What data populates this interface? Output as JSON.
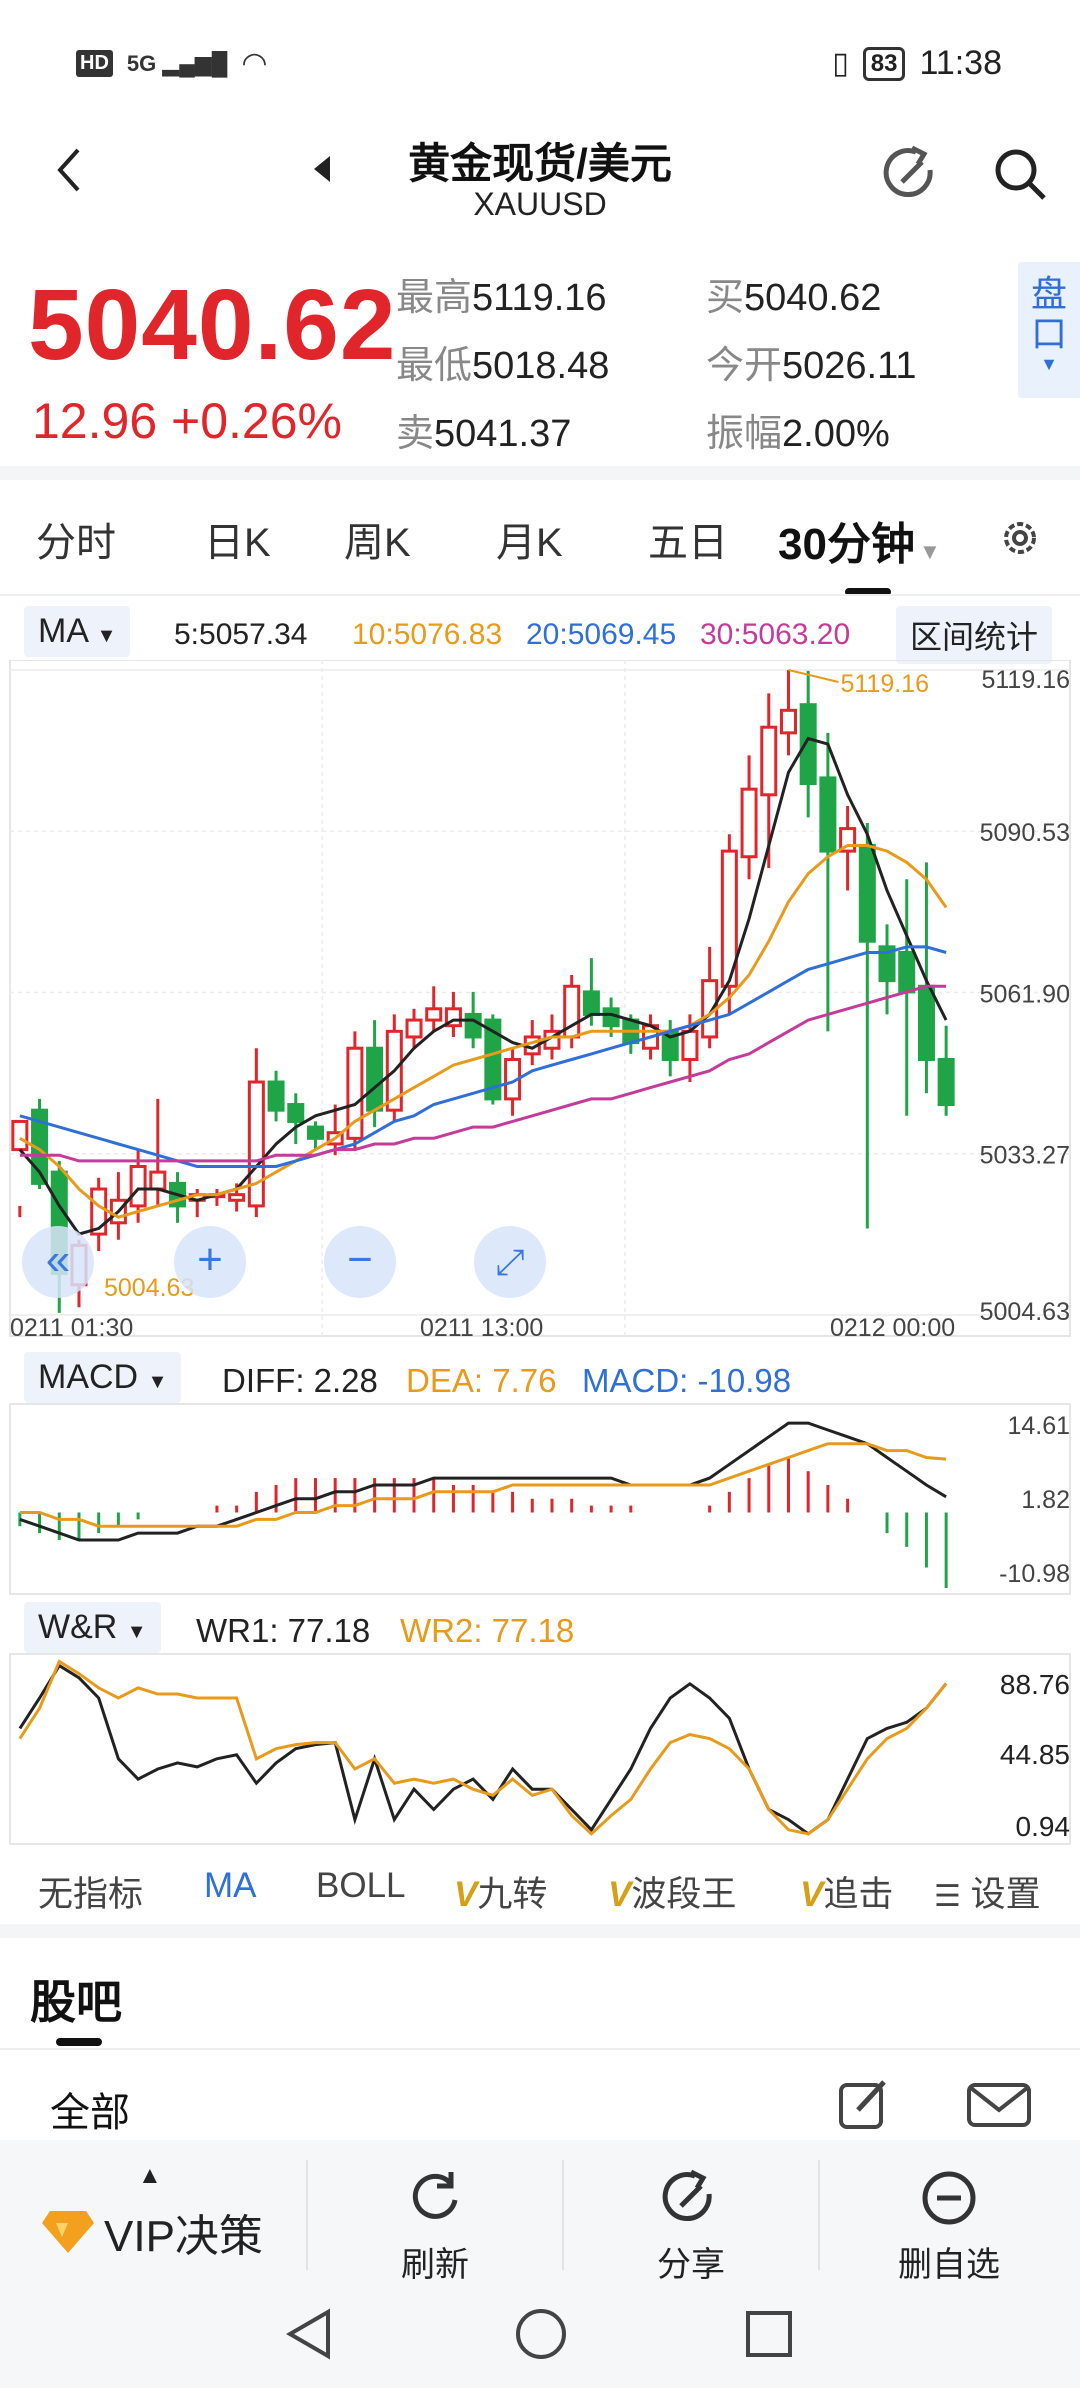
{
  "status": {
    "left_icons": [
      "HD",
      "5G",
      "signal",
      "wifi"
    ],
    "battery": "83",
    "time": "11:38"
  },
  "nav": {
    "title": "黄金现货/美元",
    "subtitle": "XAUUSD"
  },
  "quote": {
    "price": "5040.62",
    "change": "12.96  +0.26%",
    "high_label": "最高",
    "high": "5119.16",
    "low_label": "最低",
    "low": "5018.48",
    "sell_label": "卖",
    "sell": "5041.37",
    "buy_label": "买",
    "buy": "5040.62",
    "open_label": "今开",
    "open": "5026.11",
    "amp_label": "振幅",
    "amp": "2.00%",
    "pan_label": "盘口"
  },
  "tabs": [
    "分时",
    "日K",
    "周K",
    "月K",
    "五日",
    "30分钟"
  ],
  "ma_row": {
    "chip": "MA",
    "ma5": "5:5057.34",
    "ma10": "10:5076.83",
    "ma20": "20:5069.45",
    "ma30": "30:5063.20",
    "range_btn": "区间统计"
  },
  "price_axis": [
    "5119.16",
    "5090.53",
    "5061.90",
    "5033.27",
    "5004.63"
  ],
  "high_marker": "5119.16",
  "low_marker": "5004.63",
  "time_axis": [
    "0211  01:30",
    "0211  13:00",
    "0212  00:00"
  ],
  "macd_row": {
    "chip": "MACD",
    "diff": "DIFF: 2.28",
    "dea": "DEA: 7.76",
    "macd": "MACD: -10.98"
  },
  "macd_axis": [
    "14.61",
    "1.82",
    "-10.98"
  ],
  "wr_row": {
    "chip": "W&R",
    "wr1": "WR1: 77.18",
    "wr2": "WR2: 77.18"
  },
  "wr_axis": [
    "88.76",
    "44.85",
    "0.94"
  ],
  "indicators": {
    "none": "无指标",
    "ma": "MA",
    "boll": "BOLL",
    "v1": "九转",
    "v2": "波段王",
    "v3": "追击",
    "settings": "设置",
    "v_mark": "V"
  },
  "community": {
    "title": "股吧",
    "filter": "全部"
  },
  "bottom": {
    "vip": "VIP决策",
    "refresh": "刷新",
    "share": "分享",
    "remove": "删自选"
  },
  "colors": {
    "up": "#e0252b",
    "down": "#1fa547",
    "ma5": "#222222",
    "ma10": "#e89a1b",
    "ma20": "#2f6fd8",
    "ma30": "#c43b9a"
  },
  "chart_data": [
    {
      "type": "candlestick",
      "title": "30分钟",
      "ylim": [
        5004.63,
        5119.16
      ],
      "y_ticks": [
        5119.16,
        5090.53,
        5061.9,
        5033.27,
        5004.63
      ],
      "x_ticks": [
        "0211  01:30",
        "0211  13:00",
        "0212  00:00"
      ],
      "candles": [
        [
          5034,
          5039,
          5024,
          5022
        ],
        [
          5041,
          5028,
          5043,
          5027
        ],
        [
          5030,
          5012,
          5032,
          5005
        ],
        [
          5010,
          5017,
          5018,
          5006
        ],
        [
          5019,
          5027,
          5029,
          5016
        ],
        [
          5021,
          5025,
          5030,
          5018
        ],
        [
          5024,
          5031,
          5034,
          5021
        ],
        [
          5027,
          5030,
          5043,
          5024
        ],
        [
          5028,
          5024,
          5030,
          5021
        ],
        [
          5025,
          5026,
          5027,
          5022
        ],
        [
          5026,
          5026,
          5027,
          5024
        ],
        [
          5025,
          5026,
          5028,
          5023
        ],
        [
          5024,
          5046,
          5052,
          5022
        ],
        [
          5046,
          5041,
          5048,
          5039
        ],
        [
          5042,
          5039,
          5044,
          5035
        ],
        [
          5038,
          5036,
          5039,
          5034
        ],
        [
          5035,
          5037,
          5042,
          5033
        ],
        [
          5036,
          5052,
          5055,
          5034
        ],
        [
          5052,
          5041,
          5057,
          5038
        ],
        [
          5041,
          5055,
          5058,
          5039
        ],
        [
          5054,
          5057,
          5059,
          5052
        ],
        [
          5057,
          5059,
          5063,
          5055
        ],
        [
          5056,
          5059,
          5062,
          5054
        ],
        [
          5058,
          5054,
          5062,
          5052
        ],
        [
          5057,
          5043,
          5058,
          5042
        ],
        [
          5043,
          5050,
          5052,
          5040
        ],
        [
          5051,
          5054,
          5057,
          5049
        ],
        [
          5052,
          5055,
          5058,
          5050
        ],
        [
          5054,
          5063,
          5065,
          5052
        ],
        [
          5062,
          5058,
          5068,
          5056
        ],
        [
          5059,
          5056,
          5061,
          5054
        ],
        [
          5057,
          5053,
          5058,
          5051
        ],
        [
          5052,
          5056,
          5058,
          5050
        ],
        [
          5055,
          5050,
          5057,
          5047
        ],
        [
          5050,
          5055,
          5058,
          5046
        ],
        [
          5054,
          5064,
          5070,
          5052
        ],
        [
          5063,
          5087,
          5090,
          5058
        ],
        [
          5086,
          5098,
          5104,
          5082
        ],
        [
          5097,
          5109,
          5115,
          5084
        ],
        [
          5108,
          5112,
          5119.16,
          5104
        ],
        [
          5113,
          5099,
          5119,
          5093
        ],
        [
          5100,
          5087,
          5108,
          5055
        ],
        [
          5087,
          5091,
          5095,
          5080
        ],
        [
          5088,
          5071,
          5092,
          5020
        ],
        [
          5070,
          5064,
          5074,
          5058
        ],
        [
          5069,
          5062,
          5082,
          5040
        ],
        [
          5063,
          5050,
          5085,
          5044
        ],
        [
          5050,
          5042,
          5056,
          5040
        ]
      ],
      "series": [
        {
          "name": "MA5",
          "values": [
            5034,
            5030,
            5024,
            5019,
            5020,
            5023,
            5027,
            5027,
            5026,
            5025,
            5026,
            5027,
            5031,
            5035,
            5038,
            5040,
            5041,
            5042,
            5045,
            5048,
            5052,
            5055,
            5057,
            5057,
            5055,
            5053,
            5052,
            5054,
            5056,
            5058,
            5058,
            5057,
            5056,
            5054,
            5055,
            5058,
            5064,
            5075,
            5088,
            5101,
            5107,
            5106,
            5097,
            5090,
            5080,
            5072,
            5064,
            5057
          ]
        },
        {
          "name": "MA10",
          "values": [
            5036,
            5034,
            5031,
            5027,
            5024,
            5022,
            5023,
            5024,
            5025,
            5026,
            5026,
            5027,
            5028,
            5030,
            5032,
            5034,
            5036,
            5039,
            5041,
            5043,
            5045,
            5047,
            5049,
            5050,
            5051,
            5052,
            5053,
            5054,
            5054,
            5055,
            5055,
            5055,
            5055,
            5055,
            5056,
            5058,
            5061,
            5065,
            5071,
            5078,
            5083,
            5086,
            5088,
            5088,
            5087,
            5085,
            5082,
            5077
          ]
        },
        {
          "name": "MA20",
          "values": [
            5040,
            5039,
            5038,
            5037,
            5036,
            5035,
            5034,
            5033,
            5032,
            5031,
            5031,
            5031,
            5031,
            5031,
            5032,
            5033,
            5034,
            5035,
            5037,
            5039,
            5040,
            5042,
            5043,
            5044,
            5045,
            5046,
            5048,
            5049,
            5050,
            5051,
            5052,
            5053,
            5054,
            5055,
            5056,
            5057,
            5058,
            5060,
            5062,
            5064,
            5066,
            5067,
            5068,
            5069,
            5069,
            5070,
            5070,
            5069
          ]
        },
        {
          "name": "MA30",
          "values": [
            5033,
            5033,
            5033,
            5032,
            5032,
            5032,
            5032,
            5032,
            5032,
            5032,
            5032,
            5032,
            5032,
            5033,
            5033,
            5033,
            5034,
            5034,
            5035,
            5035,
            5036,
            5036,
            5037,
            5038,
            5038,
            5039,
            5040,
            5041,
            5042,
            5043,
            5043,
            5044,
            5045,
            5046,
            5047,
            5048,
            5050,
            5051,
            5053,
            5055,
            5057,
            5058,
            5059,
            5060,
            5061,
            5062,
            5063,
            5063
          ]
        }
      ]
    },
    {
      "type": "bar",
      "title": "MACD",
      "ylim": [
        -10.98,
        14.61
      ],
      "y_ticks": [
        14.61,
        1.82,
        -10.98
      ],
      "values": [
        -2,
        -3,
        -4,
        -4,
        -3,
        -2,
        -1,
        0,
        0,
        0,
        1,
        1,
        3,
        4,
        5,
        5,
        5,
        5,
        5,
        5,
        5,
        5,
        4,
        4,
        3,
        3,
        2,
        2,
        2,
        1,
        1,
        1,
        0,
        0,
        0,
        1,
        3,
        5,
        7,
        8,
        6,
        4,
        2,
        0,
        -3,
        -5,
        -8,
        -10.98
      ],
      "series": [
        {
          "name": "DIFF",
          "values": [
            -1,
            -2,
            -3,
            -4,
            -4,
            -4,
            -3,
            -3,
            -3,
            -2,
            -2,
            -1,
            0,
            1,
            2,
            2,
            3,
            3,
            4,
            4,
            4,
            5,
            5,
            5,
            5,
            5,
            5,
            5,
            5,
            5,
            5,
            4,
            4,
            4,
            4,
            5,
            7,
            9,
            11,
            13,
            13,
            12,
            11,
            10,
            8,
            6,
            4,
            2.28
          ]
        },
        {
          "name": "DEA",
          "values": [
            0,
            0,
            -1,
            -1,
            -2,
            -2,
            -2,
            -2,
            -2,
            -2,
            -2,
            -2,
            -1,
            -1,
            0,
            0,
            1,
            1,
            2,
            2,
            2,
            3,
            3,
            3,
            3,
            4,
            4,
            4,
            4,
            4,
            4,
            4,
            4,
            4,
            4,
            4,
            5,
            6,
            7,
            8,
            9,
            10,
            10,
            10,
            9,
            9,
            8,
            7.76
          ]
        }
      ]
    },
    {
      "type": "line",
      "title": "W&R",
      "ylim": [
        0.94,
        88.76
      ],
      "y_ticks": [
        88.76,
        44.85,
        0.94
      ],
      "series": [
        {
          "name": "WR1",
          "values": [
            55,
            70,
            86,
            80,
            70,
            40,
            30,
            35,
            38,
            36,
            40,
            42,
            28,
            38,
            45,
            47,
            48,
            10,
            40,
            10,
            25,
            15,
            25,
            30,
            20,
            35,
            25,
            25,
            15,
            5,
            20,
            35,
            55,
            70,
            77,
            70,
            60,
            35,
            15,
            10,
            3,
            10,
            30,
            50,
            55,
            58,
            65,
            77.18
          ]
        },
        {
          "name": "WR2",
          "values": [
            50,
            65,
            88,
            82,
            75,
            70,
            75,
            72,
            72,
            70,
            70,
            70,
            40,
            45,
            47,
            48,
            48,
            35,
            40,
            28,
            30,
            28,
            30,
            25,
            22,
            30,
            22,
            25,
            12,
            3,
            12,
            20,
            35,
            48,
            52,
            50,
            45,
            35,
            15,
            5,
            3,
            10,
            25,
            40,
            50,
            55,
            65,
            77.18
          ]
        }
      ]
    }
  ]
}
